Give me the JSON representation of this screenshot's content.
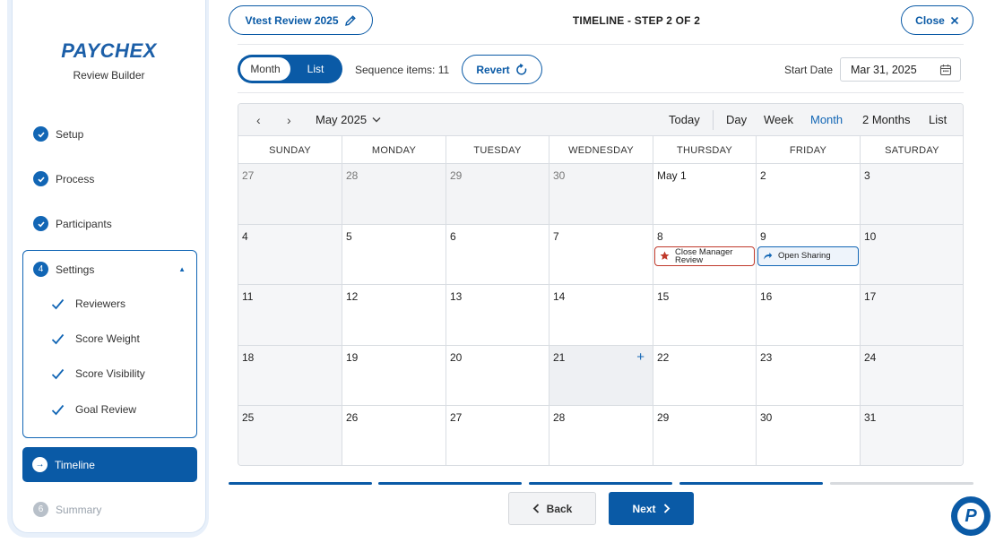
{
  "sidebar": {
    "brand": "PAYCHEX",
    "brand_sub": "Review Builder",
    "steps": [
      {
        "label": "Setup"
      },
      {
        "label": "Process"
      },
      {
        "label": "Participants"
      }
    ],
    "settings": {
      "number": "4",
      "label": "Settings",
      "items": [
        "Reviewers",
        "Score Weight",
        "Score Visibility",
        "Goal Review"
      ]
    },
    "active_step": {
      "label": "Timeline"
    },
    "disabled_step": {
      "number": "6",
      "label": "Summary"
    }
  },
  "header": {
    "review_name": "Vtest Review 2025",
    "title": "TIMELINE - STEP 2 OF 2",
    "close_label": "Close"
  },
  "toolbar": {
    "view_month": "Month",
    "view_list": "List",
    "sequence_text": "Sequence items: 11",
    "revert_label": "Revert",
    "start_date_label": "Start Date",
    "start_date_value": "Mar 31, 2025"
  },
  "calendar": {
    "month_label": "May 2025",
    "views": [
      "Today",
      "Day",
      "Week",
      "Month",
      "2 Months",
      "List"
    ],
    "active_view": "Month",
    "weekdays": [
      "SUNDAY",
      "MONDAY",
      "TUESDAY",
      "WEDNESDAY",
      "THURSDAY",
      "FRIDAY",
      "SATURDAY"
    ],
    "weeks": [
      [
        "27",
        "28",
        "29",
        "30",
        "May 1",
        "2",
        "3"
      ],
      [
        "4",
        "5",
        "6",
        "7",
        "8",
        "9",
        "10"
      ],
      [
        "11",
        "12",
        "13",
        "14",
        "15",
        "16",
        "17"
      ],
      [
        "18",
        "19",
        "20",
        "21",
        "22",
        "23",
        "24"
      ],
      [
        "25",
        "26",
        "27",
        "28",
        "29",
        "30",
        "31"
      ]
    ],
    "events": [
      {
        "label_line1": "Close Manager",
        "label_line2": "Review",
        "icon": "star-icon",
        "color": "#c0392b"
      },
      {
        "label": "Open Sharing",
        "icon": "share-arrow-icon",
        "color": "#1266b5"
      }
    ],
    "add_symbol": "+"
  },
  "progress": {
    "segments_total": 5,
    "segments_complete": 4,
    "complete_color": "#0a5aa6",
    "pending_color": "#d7dade"
  },
  "nav": {
    "back_label": "Back",
    "next_label": "Next"
  },
  "fab": {
    "letter": "P"
  }
}
